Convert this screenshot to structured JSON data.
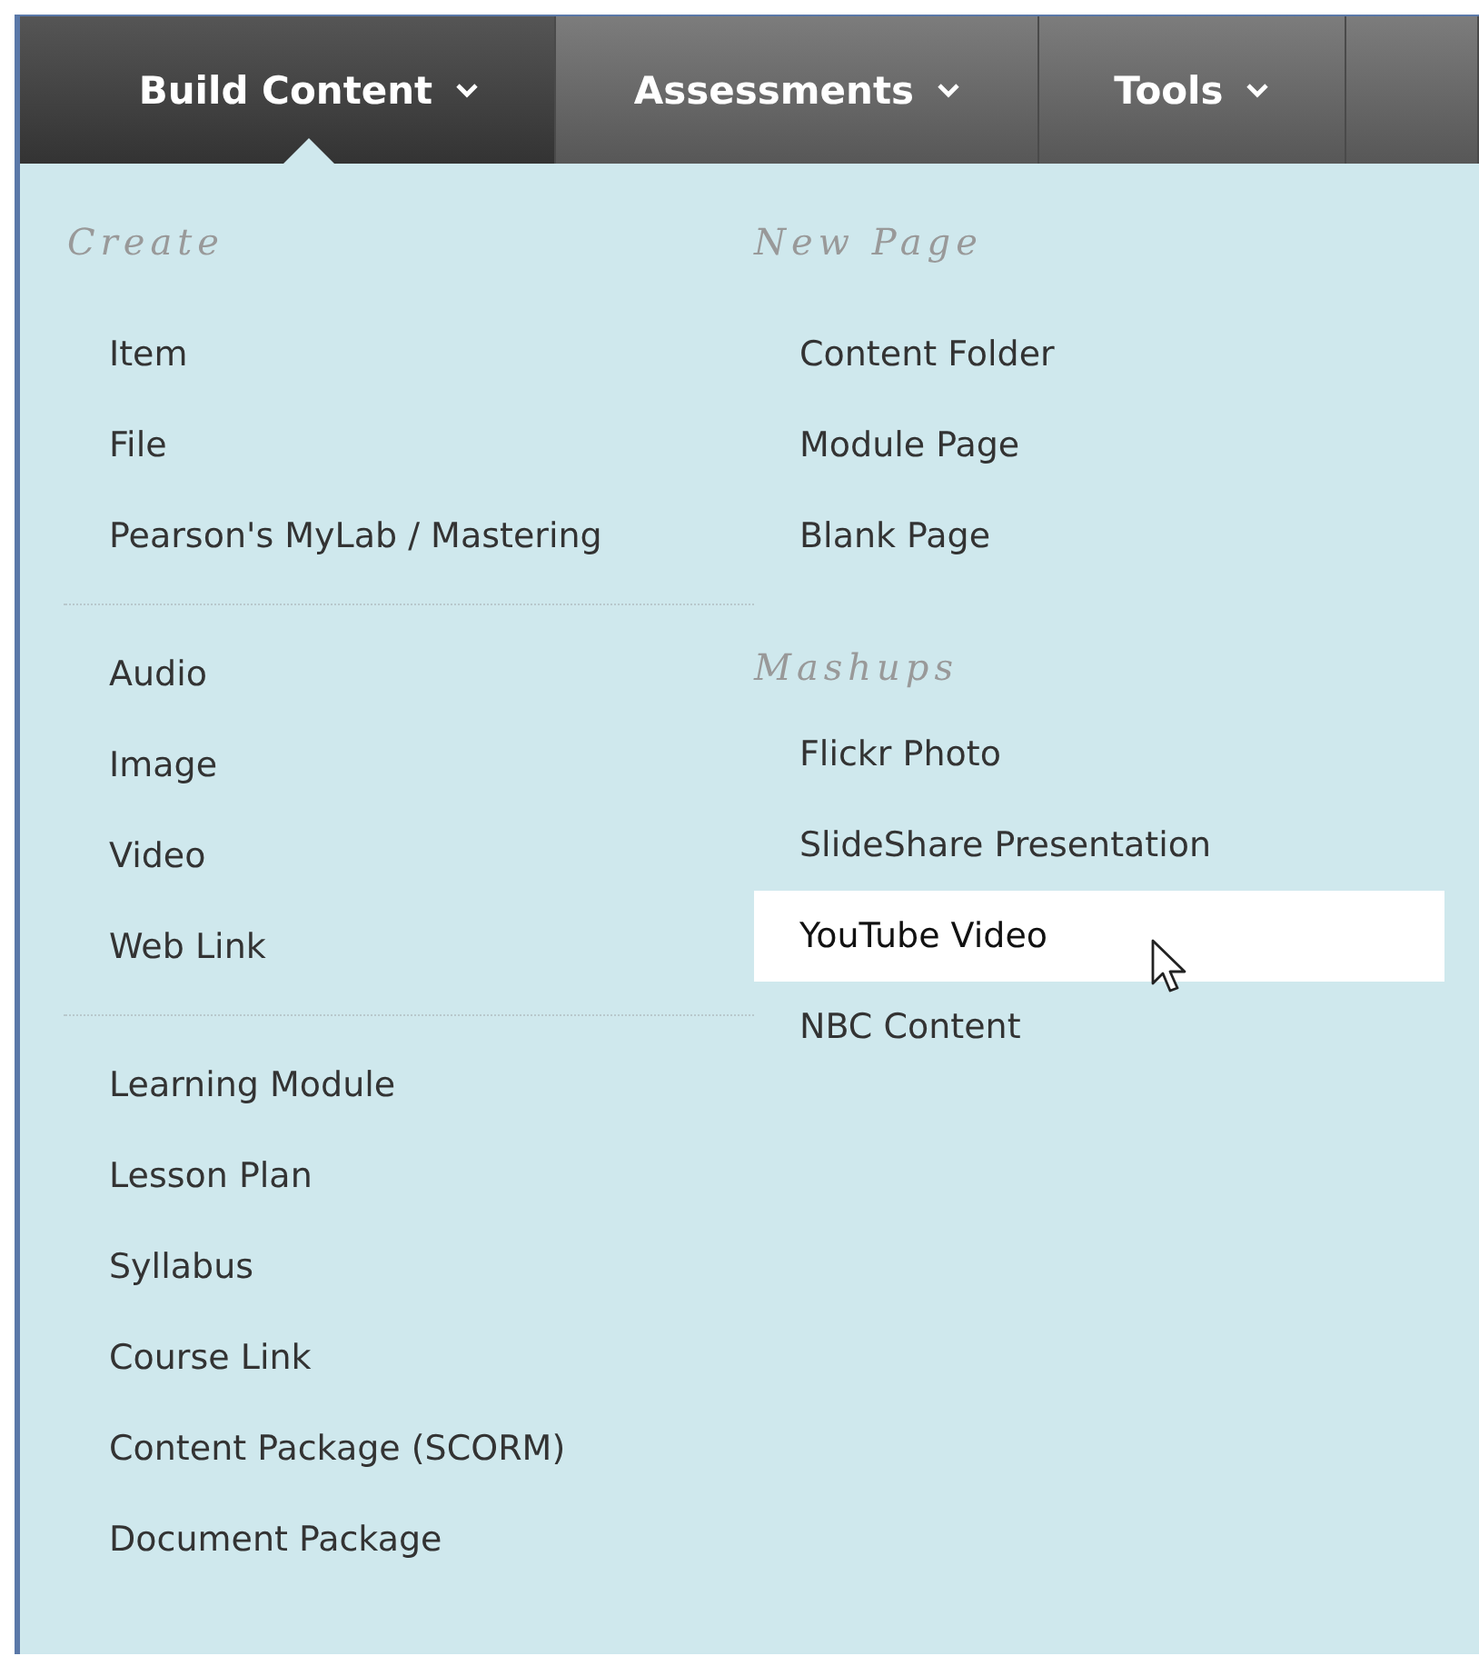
{
  "tabs": [
    {
      "label": "Build Content",
      "selected": true
    },
    {
      "label": "Assessments",
      "selected": false
    },
    {
      "label": "Tools",
      "selected": false
    }
  ],
  "columns": [
    {
      "sections": [
        {
          "heading": "Create",
          "groups": [
            [
              {
                "label": "Item",
                "selected": false
              },
              {
                "label": "File",
                "selected": false
              },
              {
                "label": "Pearson's MyLab / Mastering",
                "selected": false
              }
            ],
            [
              {
                "label": "Audio",
                "selected": false
              },
              {
                "label": "Image",
                "selected": false
              },
              {
                "label": "Video",
                "selected": false
              },
              {
                "label": "Web Link",
                "selected": false
              }
            ],
            [
              {
                "label": "Learning Module",
                "selected": false
              },
              {
                "label": "Lesson Plan",
                "selected": false
              },
              {
                "label": "Syllabus",
                "selected": false
              },
              {
                "label": "Course Link",
                "selected": false
              },
              {
                "label": "Content Package (SCORM)",
                "selected": false
              },
              {
                "label": "Document Package",
                "selected": false
              }
            ]
          ]
        }
      ]
    },
    {
      "sections": [
        {
          "heading": "New Page",
          "groups": [
            [
              {
                "label": "Content Folder",
                "selected": false
              },
              {
                "label": "Module Page",
                "selected": false
              },
              {
                "label": "Blank Page",
                "selected": false
              }
            ]
          ]
        },
        {
          "heading": "Mashups",
          "groups": [
            [
              {
                "label": "Flickr Photo",
                "selected": false
              },
              {
                "label": "SlideShare Presentation",
                "selected": false
              },
              {
                "label": "YouTube Video",
                "selected": true
              },
              {
                "label": "NBC Content",
                "selected": false
              }
            ]
          ]
        }
      ]
    }
  ]
}
